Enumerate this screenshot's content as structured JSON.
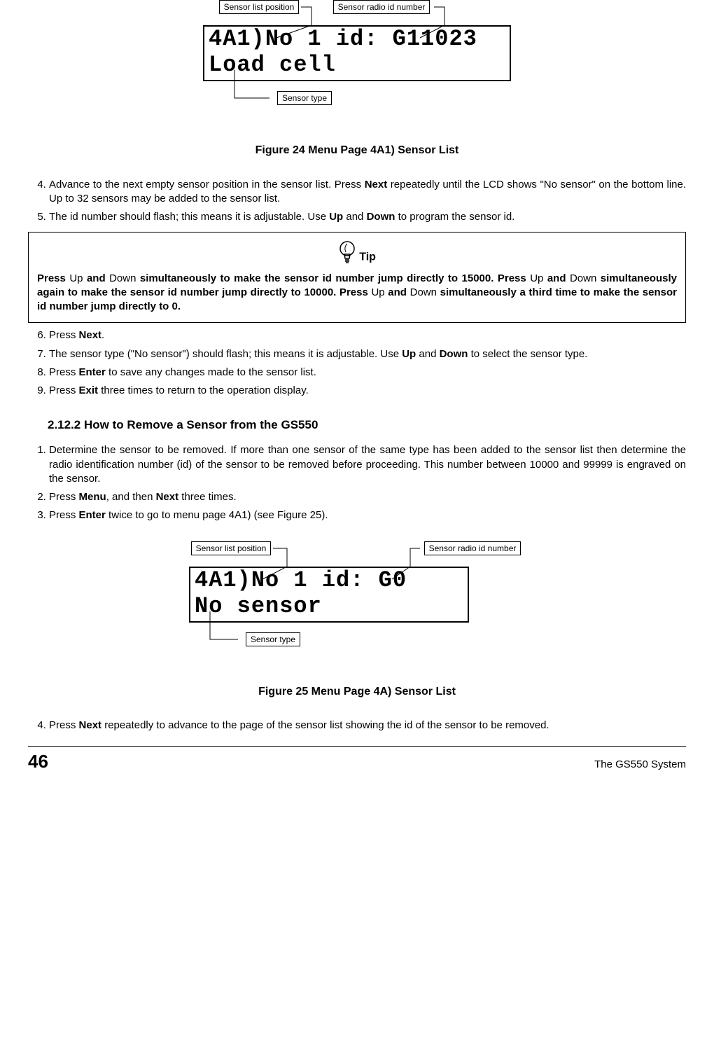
{
  "figure24": {
    "callout_position": "Sensor list position",
    "callout_radio": "Sensor radio id number",
    "callout_type": "Sensor type",
    "lcd_line1": "4A1)No 1 id: G11023",
    "lcd_line2": "Load cell",
    "caption": "Figure 24  Menu Page 4A1) Sensor List"
  },
  "steps_a": {
    "s4a": "Advance to the next empty sensor position in the sensor list. Press ",
    "s4b": "Next",
    "s4c": " repeatedly until the LCD shows \"No sensor\" on the bottom line. Up to 32 sensors may be added to the sensor list.",
    "s5a": "The id number should flash; this means it is adjustable. Use ",
    "s5b": "Up",
    "s5c": " and ",
    "s5d": "Down",
    "s5e": " to program the sensor id."
  },
  "tip": {
    "label": "Tip",
    "t1": "Press ",
    "u1": "Up",
    "t2": " and ",
    "d1": "Down",
    "t3": " simultaneously to make the sensor id number jump directly to 15000. Press ",
    "u2": "Up",
    "t4": " and ",
    "d2": "Down",
    "t5": " simultaneously again to make the sensor id number jump directly to 10000. Press ",
    "u3": "Up",
    "t6": " and ",
    "d3": "Down",
    "t7": " simultaneously a third time to make the sensor id number jump directly to 0."
  },
  "steps_b": {
    "s6a": "Press ",
    "s6b": "Next",
    "s6c": ".",
    "s7a": "The sensor type (\"No sensor\") should flash; this means it is adjustable. Use ",
    "s7b": "Up",
    "s7c": " and ",
    "s7d": "Down",
    "s7e": " to select the sensor type.",
    "s8a": "Press ",
    "s8b": "Enter",
    "s8c": " to save any changes made to the sensor list.",
    "s9a": "Press ",
    "s9b": "Exit",
    "s9c": " three times to return to the operation display."
  },
  "subsection": "2.12.2 How to Remove a Sensor from the GS550",
  "steps_c": {
    "s1": "Determine the sensor to be removed. If more than one sensor of the same type has been added to the sensor list then determine the radio identification number (id) of the sensor to be removed before proceeding. This number between 10000 and 99999 is engraved on the sensor.",
    "s2a": "Press ",
    "s2b": "Menu",
    "s2c": ", and then ",
    "s2d": "Next",
    "s2e": " three times.",
    "s3a": "Press ",
    "s3b": "Enter",
    "s3c": " twice to go to menu page 4A1) (see Figure 25)."
  },
  "figure25": {
    "callout_position": "Sensor list position",
    "callout_radio": "Sensor radio id number",
    "callout_type": "Sensor type",
    "lcd_line1": "4A1)No 1 id: G0",
    "lcd_line2": "No sensor",
    "caption": "Figure 25  Menu Page 4A) Sensor List"
  },
  "steps_d": {
    "s4a": "Press ",
    "s4b": "Next",
    "s4c": " repeatedly to advance to the page of the sensor list showing the id of the sensor to be removed."
  },
  "footer": {
    "page": "46",
    "system": "The GS550 System"
  }
}
